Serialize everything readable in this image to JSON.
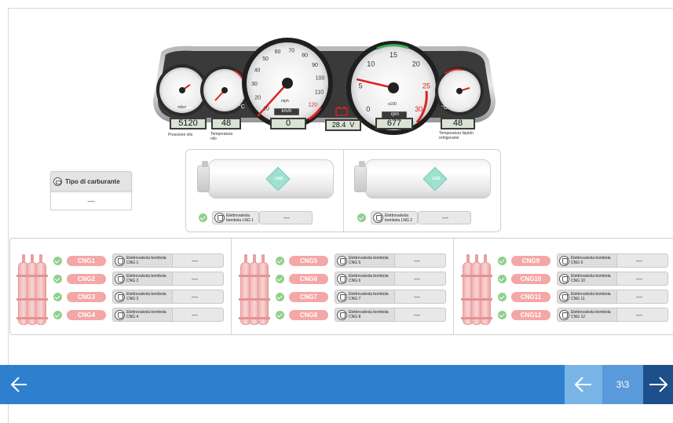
{
  "dashboard": {
    "oil_pressure": {
      "value": "5120",
      "label": "Pressione olio",
      "unit": "mbar"
    },
    "oil_temp": {
      "value": "48",
      "label": "Temperatura olio",
      "unit": "°C"
    },
    "speed": {
      "value": "0",
      "unit": "km/h",
      "subunit": "mph"
    },
    "battery": {
      "value": "28.4",
      "unit": "V"
    },
    "rpm": {
      "value": "677",
      "unit": "rpm",
      "subunit": "x100"
    },
    "coolant_temp": {
      "value": "48",
      "label": "Temperatura liquido refrigerante",
      "unit": "°C"
    },
    "speed_ticks": [
      "10",
      "20",
      "30",
      "40",
      "50",
      "60",
      "70",
      "80",
      "90",
      "100",
      "110",
      "120"
    ],
    "rpm_ticks": [
      "0",
      "5",
      "10",
      "15",
      "20",
      "25",
      "30"
    ]
  },
  "fuel_type": {
    "label": "Tipo di carburante",
    "value": "—"
  },
  "lng": {
    "logo": "LNG",
    "tanks": [
      {
        "valve_label": "Elettrovalvola bombola LNG 1",
        "value": "—"
      },
      {
        "valve_label": "Elettrovalvola bombola LNG 2",
        "value": "—"
      }
    ]
  },
  "cng_groups": [
    {
      "items": [
        {
          "tag": "CNG1",
          "valve": "Elettrovalvola bombola CNG 1",
          "value": "—"
        },
        {
          "tag": "CNG2",
          "valve": "Elettrovalvola bombola CNG 2",
          "value": "—"
        },
        {
          "tag": "CNG3",
          "valve": "Elettrovalvola bombola CNG 3",
          "value": "—"
        },
        {
          "tag": "CNG4",
          "valve": "Elettrovalvola bombola CNG 4",
          "value": "—"
        }
      ]
    },
    {
      "items": [
        {
          "tag": "CNG5",
          "valve": "Elettrovalvola bombola CNG 5",
          "value": "—"
        },
        {
          "tag": "CNG6",
          "valve": "Elettrovalvola bombola CNG 6",
          "value": "—"
        },
        {
          "tag": "CNG7",
          "valve": "Elettrovalvola bombola CNG 7",
          "value": "—"
        },
        {
          "tag": "CNG8",
          "valve": "Elettrovalvola bombola CNG 8",
          "value": "—"
        }
      ]
    },
    {
      "items": [
        {
          "tag": "CNG9",
          "valve": "Elettrovalvola bombola CNG 9",
          "value": "—"
        },
        {
          "tag": "CNG10",
          "valve": "Elettrovalvola bombola CNG 10",
          "value": "—"
        },
        {
          "tag": "CNG11",
          "valve": "Elettrovalvola bombola CNG 11",
          "value": "—"
        },
        {
          "tag": "CNG12",
          "valve": "Elettrovalvola bombola CNG 12",
          "value": "—"
        }
      ]
    }
  ],
  "nav": {
    "page_indicator": "3\\3",
    "back_icon": "arrow-left-icon",
    "prev_icon": "arrow-left-icon",
    "next_icon": "arrow-right-icon"
  },
  "colors": {
    "bar": "#2f7fcf",
    "prev": "#78b4e6",
    "page": "#5a9ada",
    "next": "#1d4f8a",
    "cng_red": "#f5a6a6",
    "ok_green": "#8fcf8f"
  }
}
